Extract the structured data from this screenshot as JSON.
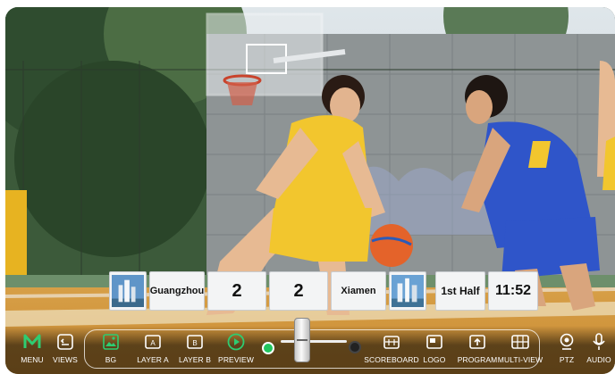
{
  "scoreboard": {
    "home_team": "Guangzhou",
    "home_score": "2",
    "away_score": "2",
    "away_team": "Xiamen",
    "period": "1st Half",
    "clock": "11:52"
  },
  "toolbar": {
    "items": [
      {
        "label": "MENU",
        "icon": "menu-m-icon"
      },
      {
        "label": "VIEWS",
        "icon": "views-icon"
      },
      {
        "label": "BG",
        "icon": "image-icon"
      },
      {
        "label": "LAYER A",
        "icon": "layer-a-icon"
      },
      {
        "label": "LAYER B",
        "icon": "layer-b-icon"
      },
      {
        "label": "PREVIEW",
        "icon": "play-icon"
      },
      {
        "label": "SCOREBOARD",
        "icon": "scoreboard-icon"
      },
      {
        "label": "LOGO",
        "icon": "logo-icon"
      },
      {
        "label": "PROGRAM",
        "icon": "upload-icon"
      },
      {
        "label": "MULTI-VIEW",
        "icon": "multiview-icon"
      },
      {
        "label": "PTZ",
        "icon": "camera-icon"
      },
      {
        "label": "AUDIO",
        "icon": "microphone-icon"
      }
    ],
    "fader": {
      "preview_dot_color": "#22c55e",
      "program_dot_color": "#222222"
    }
  },
  "colors": {
    "accent_green": "#2ecc71",
    "jersey_yellow": "#f2c62e",
    "jersey_blue": "#2f55c9"
  }
}
